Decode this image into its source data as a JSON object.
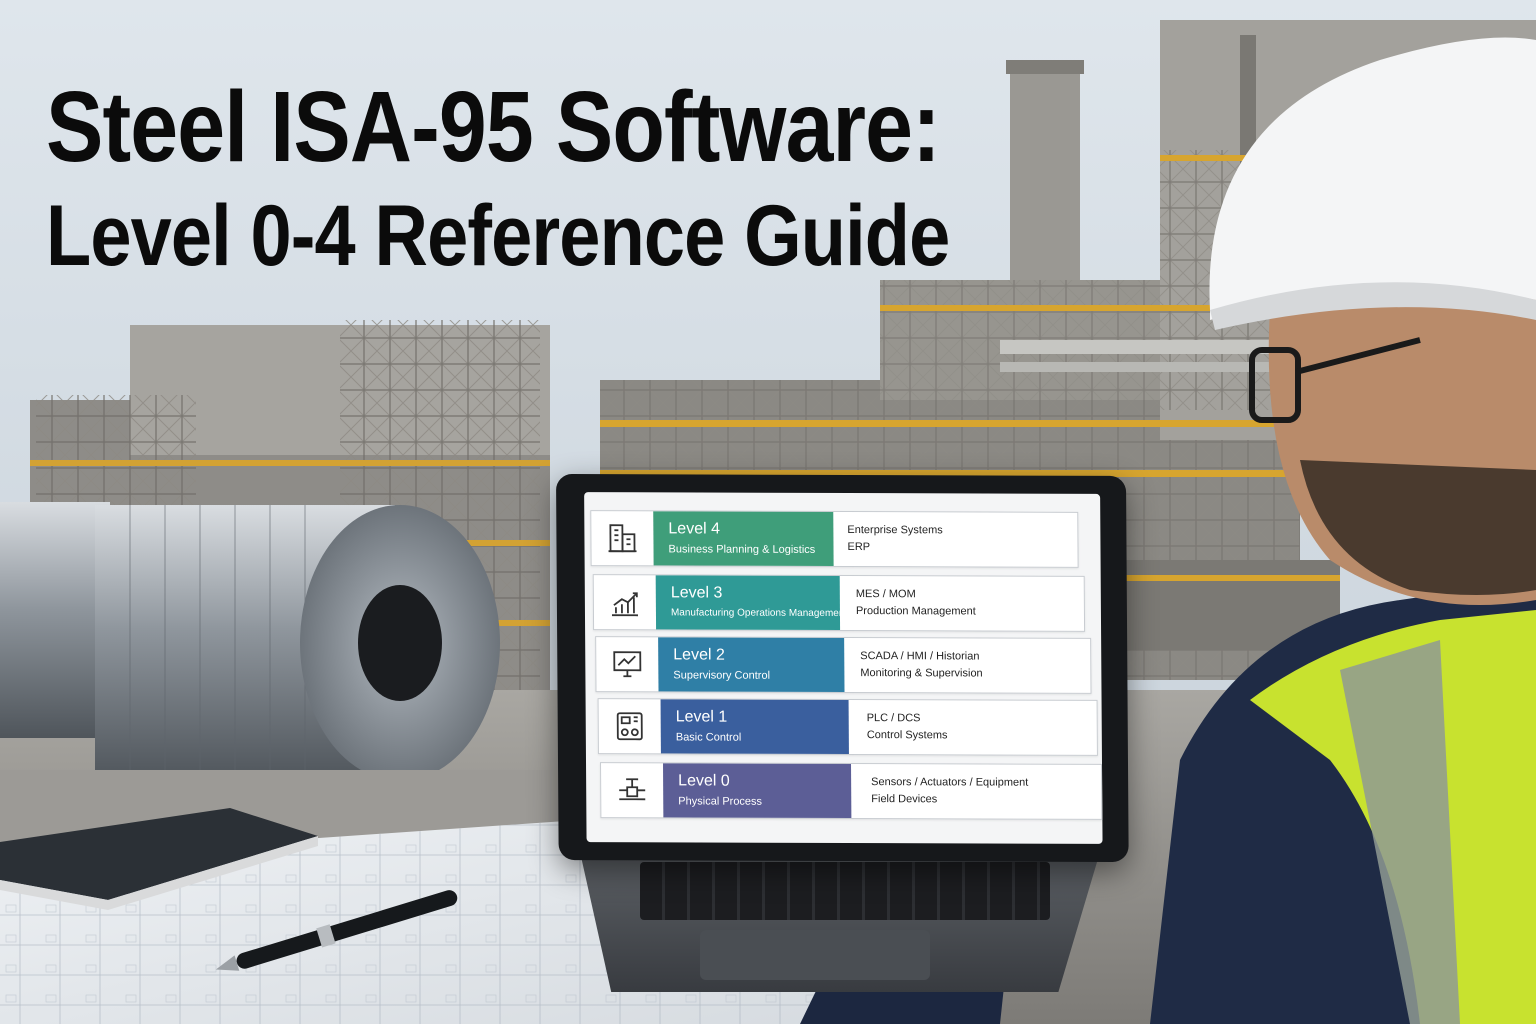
{
  "title": {
    "line1": "Steel ISA-95 Software:",
    "line2": "Level 0-4 Reference Guide"
  },
  "levels": [
    {
      "name": "Level 4",
      "subtitle": "Business Planning & Logistics",
      "desc1": "Enterprise Systems",
      "desc2": "ERP",
      "color": "#3f9e7a",
      "icon": "buildings-icon"
    },
    {
      "name": "Level 3",
      "subtitle": "Manufacturing Operations Management",
      "desc1": "MES / MOM",
      "desc2": "Production Management",
      "color": "#2f9a96",
      "icon": "growth-chart-icon"
    },
    {
      "name": "Level 2",
      "subtitle": "Supervisory Control",
      "desc1": "SCADA / HMI / Historian",
      "desc2": "Monitoring & Supervision",
      "color": "#2f7fa6",
      "icon": "monitor-chart-icon"
    },
    {
      "name": "Level 1",
      "subtitle": "Basic Control",
      "desc1": "PLC / DCS",
      "desc2": "Control Systems",
      "color": "#3a5f9e",
      "icon": "plc-controller-icon"
    },
    {
      "name": "Level 0",
      "subtitle": "Physical Process",
      "desc1": "Sensors / Actuators / Equipment",
      "desc2": "Field Devices",
      "color": "#5c5e96",
      "icon": "valve-pipe-icon"
    }
  ]
}
